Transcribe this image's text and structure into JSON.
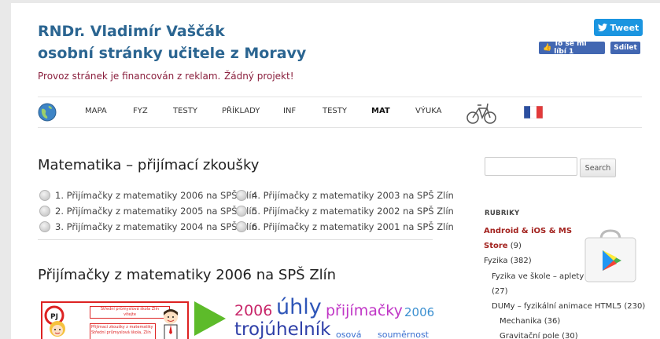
{
  "header": {
    "title_line1": "RNDr. Vladimír Vaščák",
    "title_line2": "osobní stránky učitele z Moravy",
    "tagline_left": "Provoz stránek je financován z reklam.",
    "tagline_right": "Žádný projekt!"
  },
  "social": {
    "tweet_label": "Tweet",
    "like_label": "To se mi líbí 1",
    "share_label": "Sdílet"
  },
  "nav": {
    "items": [
      "MAPA",
      "FYZ",
      "TESTY",
      "PŘÍKLADY",
      "INF",
      "TESTY",
      "MAT",
      "VÝUKA"
    ]
  },
  "main": {
    "heading": "Matematika – přijímací zkoušky",
    "toc_left": [
      "1. Přijímačky z matematiky 2006 na SPŠ Zlín",
      "2. Přijímačky z matematiky 2005 na SPŠ Zlín",
      "3. Přijímačky z matematiky 2004 na SPŠ Zlín"
    ],
    "toc_right": [
      "4. Přijímačky z matematiky 2003 na SPŠ Zlín",
      "5. Přijímačky z matematiky 2002 na SPŠ Zlín",
      "6. Přijímačky z matematiky 2001 na SPŠ Zlín"
    ],
    "subheading": "Přijímačky z matematiky 2006 na SPŠ Zlín",
    "thumb_lines": [
      "Střední průmyslová škola Zlín",
      "vítejte",
      "Přijímací zkoušky z matematiky",
      "Střední průmyslová škola, Zlín"
    ],
    "tags": [
      "2006",
      "úhly",
      "přijímačky",
      "2006",
      "trojúhelník",
      "osová",
      "souměrnost"
    ]
  },
  "sidebar": {
    "search_button": "Search",
    "rubriky_label": "RUBRIKY",
    "link_android": "Android & iOS & MS",
    "link_store": "Store",
    "store_count": "(9)",
    "fyzika": "Fyzika (382)",
    "fyzika_ve_skole": "Fyzika ve škole – aplety",
    "fyzika_ve_skole_count": "(27)",
    "dumy": "DUMy – fyzikální animace HTML5 (230)",
    "mechanika": "Mechanika (36)",
    "gravitacni": "Gravitační pole (30)"
  }
}
